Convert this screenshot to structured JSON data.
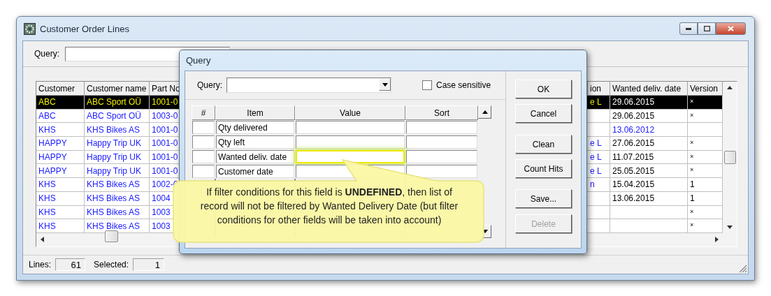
{
  "window": {
    "title": "Customer Order Lines"
  },
  "query_bar": {
    "label": "Query:"
  },
  "table": {
    "columns": [
      "Customer",
      "Customer name",
      "Part No",
      "ion",
      "Wanted deliv. date",
      "Version"
    ],
    "rows": [
      {
        "cells": [
          "ABC",
          "ABC Sport OÜ",
          "1001-0",
          "e L",
          "29.06.2015",
          "×"
        ],
        "selected": true,
        "date_highlighted": false
      },
      {
        "cells": [
          "ABC",
          "ABC Sport OÜ",
          "1003-0",
          "",
          "29.06.2015",
          "×"
        ],
        "selected": false,
        "date_highlighted": false
      },
      {
        "cells": [
          "KHS",
          "KHS Bikes AS",
          "1001-0",
          "",
          "13.06.2012",
          ""
        ],
        "selected": false,
        "date_highlighted": true
      },
      {
        "cells": [
          "HAPPY",
          "Happy Trip UK",
          "1001-0",
          "e L",
          "27.06.2015",
          "×"
        ],
        "selected": false,
        "date_highlighted": false
      },
      {
        "cells": [
          "HAPPY",
          "Happy Trip UK",
          "1001-0",
          "e L",
          "11.07.2015",
          "×"
        ],
        "selected": false,
        "date_highlighted": false
      },
      {
        "cells": [
          "HAPPY",
          "Happy Trip UK",
          "1001-0",
          "e L",
          "25.05.2015",
          "×"
        ],
        "selected": false,
        "date_highlighted": false
      },
      {
        "cells": [
          "KHS",
          "KHS Bikes AS",
          "1002-0",
          "n",
          "15.04.2015",
          "1"
        ],
        "selected": false,
        "date_highlighted": false
      },
      {
        "cells": [
          "KHS",
          "KHS Bikes AS",
          "1004",
          "",
          "13.06.2015",
          "1"
        ],
        "selected": false,
        "date_highlighted": false
      },
      {
        "cells": [
          "KHS",
          "KHS Bikes AS",
          "1003",
          "",
          "",
          "×"
        ],
        "selected": false
      },
      {
        "cells": [
          "KHS",
          "KHS Bikes AS",
          "1003",
          "",
          "",
          "×"
        ],
        "selected": false
      }
    ]
  },
  "status_bar": {
    "lines_label": "Lines:",
    "lines": "61",
    "selected_label": "Selected:",
    "selected": "1"
  },
  "dialog": {
    "title": "Query",
    "query_label": "Query:",
    "case_sensitive": {
      "label": "Case sensitive",
      "checked": false
    },
    "columns": [
      "#",
      "Item",
      "Value",
      "Sort"
    ],
    "rows": [
      {
        "item": "Qty delivered",
        "highlighted": false
      },
      {
        "item": "Qty left",
        "highlighted": false
      },
      {
        "item": "Wanted deliv. date",
        "highlighted": true
      },
      {
        "item": "Customer date",
        "highlighted": false
      }
    ],
    "buttons": [
      {
        "label": "OK",
        "disabled": false
      },
      {
        "label": "Cancel",
        "disabled": false
      },
      {
        "label": "Clean",
        "disabled": false
      },
      {
        "label": "Count Hits",
        "disabled": false
      },
      {
        "label": "Save...",
        "disabled": false
      },
      {
        "label": "Delete",
        "disabled": true
      }
    ]
  },
  "callout": {
    "text": "If filter conditions for this field is **UNDEFINED**, then list of record will not be filtered by Wanted Delivery Date (but filter conditions for other fields will be taken into account)"
  }
}
